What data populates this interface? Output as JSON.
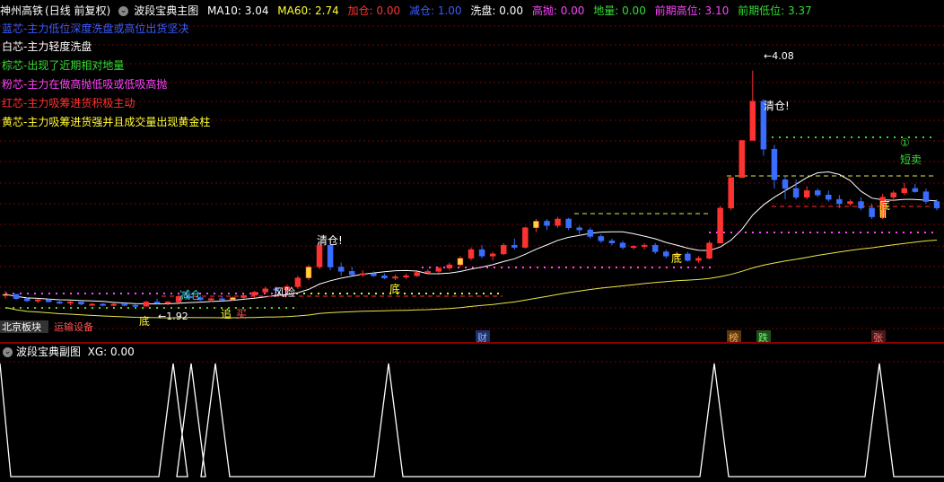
{
  "header": {
    "stock": "神州高铁",
    "period": "(日线 前复权)",
    "indicator": "波段宝典主图",
    "ma10_label": "MA10:",
    "ma10_value": "3.04",
    "ma60_label": "MA60:",
    "ma60_value": "2.74",
    "jiacang_label": "加仓:",
    "jiacang_value": "0.00",
    "jiancang_label": "减仓:",
    "jiancang_value": "1.00",
    "xipan_label": "洗盘:",
    "xipan_value": "0.00",
    "gaopao_label": "高抛:",
    "gaopao_value": "0.00",
    "diliang_label": "地量:",
    "diliang_value": "0.00",
    "qqgw_label": "前期高位:",
    "qqgw_value": "3.10",
    "qqdw_label": "前期低位:",
    "qqdw_value": "3.37"
  },
  "legend": [
    {
      "text": "蓝芯-主力低位深度洗盘或高位出货坚决",
      "color": "#3a5cff"
    },
    {
      "text": "白芯-主力轻度洗盘",
      "color": "#ffffff"
    },
    {
      "text": "棕芯-出现了近期相对地量",
      "color": "#33dd33"
    },
    {
      "text": "粉芯-主力在做高抛低吸或低吸高抛",
      "color": "#ff44ff"
    },
    {
      "text": "红芯-主力吸筹进货积极主动",
      "color": "#ff3333"
    },
    {
      "text": "黄芯-主力吸筹进货强并且成交量出现黄金柱",
      "color": "#ffff33"
    }
  ],
  "annotations": {
    "high_price": "4.08",
    "low_price": "1.92",
    "qingcang1": "清仓!",
    "qingcang2": "清仓!",
    "jiancang": "减仓",
    "fengxian": "风险",
    "zhui": "追",
    "mai": "买",
    "di1": "底",
    "di2": "底",
    "di3": "底",
    "di4": "底",
    "di5": "底",
    "circle1": "①",
    "duanmai": "短卖",
    "roman": "Ⅲ"
  },
  "bottom_tags": {
    "sector1": "北京板块",
    "sector2": "运输设备",
    "cai": "财",
    "bang": "榜",
    "die": "跌",
    "zhang": "张"
  },
  "sub_header": {
    "indicator": "波段宝典副图",
    "xg_label": "XG:",
    "xg_value": "0.00"
  },
  "colors": {
    "up": "#ff3232",
    "down": "#3a6cff",
    "ma_white": "#ffffff",
    "ma_yellow": "#e8e84a",
    "grid": "#7a0000"
  },
  "chart_data": {
    "type": "candlestick",
    "candles": [
      [
        2.02,
        2.06,
        1.99,
        2.03
      ],
      [
        2.03,
        2.03,
        1.98,
        1.99
      ],
      [
        1.99,
        2.0,
        1.96,
        1.97
      ],
      [
        1.97,
        1.99,
        1.95,
        1.98
      ],
      [
        1.98,
        1.99,
        1.96,
        1.96
      ],
      [
        1.96,
        1.97,
        1.94,
        1.95
      ],
      [
        1.95,
        1.97,
        1.93,
        1.96
      ],
      [
        1.96,
        1.96,
        1.93,
        1.94
      ],
      [
        1.94,
        1.95,
        1.93,
        1.94
      ],
      [
        1.94,
        1.95,
        1.92,
        1.93
      ],
      [
        1.93,
        1.95,
        1.92,
        1.94
      ],
      [
        1.94,
        1.96,
        1.92,
        1.93
      ],
      [
        1.93,
        1.94,
        1.92,
        1.92
      ],
      [
        1.92,
        1.97,
        1.92,
        1.96
      ],
      [
        1.96,
        1.99,
        1.94,
        1.95
      ],
      [
        1.95,
        1.97,
        1.93,
        1.96
      ],
      [
        1.96,
        2.02,
        1.95,
        2.01
      ],
      [
        2.01,
        2.04,
        1.99,
        2.0
      ],
      [
        2.0,
        2.02,
        1.97,
        1.98
      ],
      [
        1.98,
        2.0,
        1.96,
        1.99
      ],
      [
        1.99,
        2.01,
        1.97,
        1.98
      ],
      [
        1.98,
        2.01,
        1.97,
        2.0
      ],
      [
        2.0,
        2.03,
        1.99,
        2.02
      ],
      [
        2.02,
        2.06,
        2.0,
        2.05
      ],
      [
        2.05,
        2.1,
        2.03,
        2.08
      ],
      [
        2.08,
        2.1,
        2.05,
        2.07
      ],
      [
        2.07,
        2.12,
        2.05,
        2.1
      ],
      [
        2.1,
        2.2,
        2.08,
        2.18
      ],
      [
        2.18,
        2.3,
        2.16,
        2.28
      ],
      [
        2.28,
        2.5,
        2.26,
        2.48
      ],
      [
        2.48,
        2.52,
        2.25,
        2.28
      ],
      [
        2.28,
        2.32,
        2.2,
        2.24
      ],
      [
        2.24,
        2.28,
        2.2,
        2.21
      ],
      [
        2.21,
        2.25,
        2.19,
        2.22
      ],
      [
        2.22,
        2.24,
        2.19,
        2.2
      ],
      [
        2.2,
        2.22,
        2.17,
        2.18
      ],
      [
        2.18,
        2.21,
        2.16,
        2.19
      ],
      [
        2.19,
        2.22,
        2.17,
        2.2
      ],
      [
        2.2,
        2.24,
        2.19,
        2.23
      ],
      [
        2.23,
        2.26,
        2.21,
        2.24
      ],
      [
        2.24,
        2.28,
        2.22,
        2.27
      ],
      [
        2.27,
        2.32,
        2.25,
        2.3
      ],
      [
        2.3,
        2.38,
        2.28,
        2.36
      ],
      [
        2.36,
        2.46,
        2.34,
        2.44
      ],
      [
        2.44,
        2.48,
        2.36,
        2.38
      ],
      [
        2.38,
        2.42,
        2.34,
        2.4
      ],
      [
        2.4,
        2.5,
        2.39,
        2.48
      ],
      [
        2.48,
        2.54,
        2.44,
        2.46
      ],
      [
        2.46,
        2.65,
        2.45,
        2.64
      ],
      [
        2.64,
        2.72,
        2.6,
        2.7
      ],
      [
        2.7,
        2.72,
        2.62,
        2.66
      ],
      [
        2.66,
        2.74,
        2.64,
        2.72
      ],
      [
        2.72,
        2.73,
        2.62,
        2.64
      ],
      [
        2.64,
        2.66,
        2.58,
        2.62
      ],
      [
        2.62,
        2.64,
        2.54,
        2.56
      ],
      [
        2.56,
        2.58,
        2.5,
        2.52
      ],
      [
        2.52,
        2.54,
        2.48,
        2.5
      ],
      [
        2.5,
        2.52,
        2.44,
        2.46
      ],
      [
        2.46,
        2.48,
        2.44,
        2.47
      ],
      [
        2.47,
        2.5,
        2.44,
        2.48
      ],
      [
        2.48,
        2.5,
        2.4,
        2.42
      ],
      [
        2.42,
        2.44,
        2.36,
        2.38
      ],
      [
        2.38,
        2.42,
        2.35,
        2.4
      ],
      [
        2.4,
        2.42,
        2.33,
        2.34
      ],
      [
        2.34,
        2.38,
        2.32,
        2.36
      ],
      [
        2.36,
        2.52,
        2.35,
        2.5
      ],
      [
        2.5,
        2.84,
        2.5,
        2.82
      ],
      [
        2.82,
        3.1,
        2.8,
        3.1
      ],
      [
        3.1,
        3.44,
        3.1,
        3.44
      ],
      [
        3.44,
        4.08,
        3.44,
        3.8
      ],
      [
        3.8,
        3.82,
        3.3,
        3.36
      ],
      [
        3.36,
        3.4,
        3.0,
        3.08
      ],
      [
        3.08,
        3.12,
        2.9,
        3.0
      ],
      [
        3.0,
        3.08,
        2.9,
        2.92
      ],
      [
        2.92,
        3.02,
        2.9,
        2.98
      ],
      [
        2.98,
        3.0,
        2.92,
        2.94
      ],
      [
        2.94,
        2.98,
        2.88,
        2.9
      ],
      [
        2.9,
        2.94,
        2.82,
        2.86
      ],
      [
        2.86,
        2.9,
        2.84,
        2.88
      ],
      [
        2.88,
        2.92,
        2.8,
        2.82
      ],
      [
        2.82,
        2.86,
        2.72,
        2.74
      ],
      [
        2.74,
        2.95,
        2.72,
        2.92
      ],
      [
        2.92,
        2.98,
        2.88,
        2.96
      ],
      [
        2.96,
        3.05,
        2.94,
        3.0
      ],
      [
        3.0,
        3.04,
        2.96,
        2.97
      ],
      [
        2.97,
        3.0,
        2.86,
        2.88
      ],
      [
        2.88,
        2.9,
        2.8,
        2.82
      ]
    ]
  }
}
